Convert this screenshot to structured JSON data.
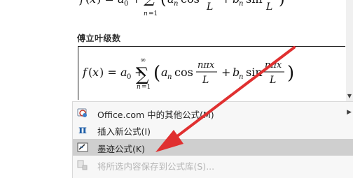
{
  "gallery": {
    "section_title": "傅立叶级数"
  },
  "menu": {
    "items": [
      {
        "label": "Office.com 中的其他公式(M)",
        "icon": "office-gallery-icon",
        "enabled": true,
        "submenu": true
      },
      {
        "label": "插入新公式(I)",
        "icon": "pi-icon",
        "enabled": true,
        "submenu": false
      },
      {
        "label": "墨迹公式(K)",
        "icon": "ink-equation-icon",
        "enabled": true,
        "submenu": false,
        "highlighted": true
      },
      {
        "label": "将所选内容保存到公式库(S)...",
        "icon": "save-to-gallery-icon",
        "enabled": false,
        "submenu": false
      }
    ]
  },
  "colors": {
    "highlight": "#cfcfcf",
    "arrow": "#e03030",
    "pi_blue": "#1f5fa8"
  }
}
